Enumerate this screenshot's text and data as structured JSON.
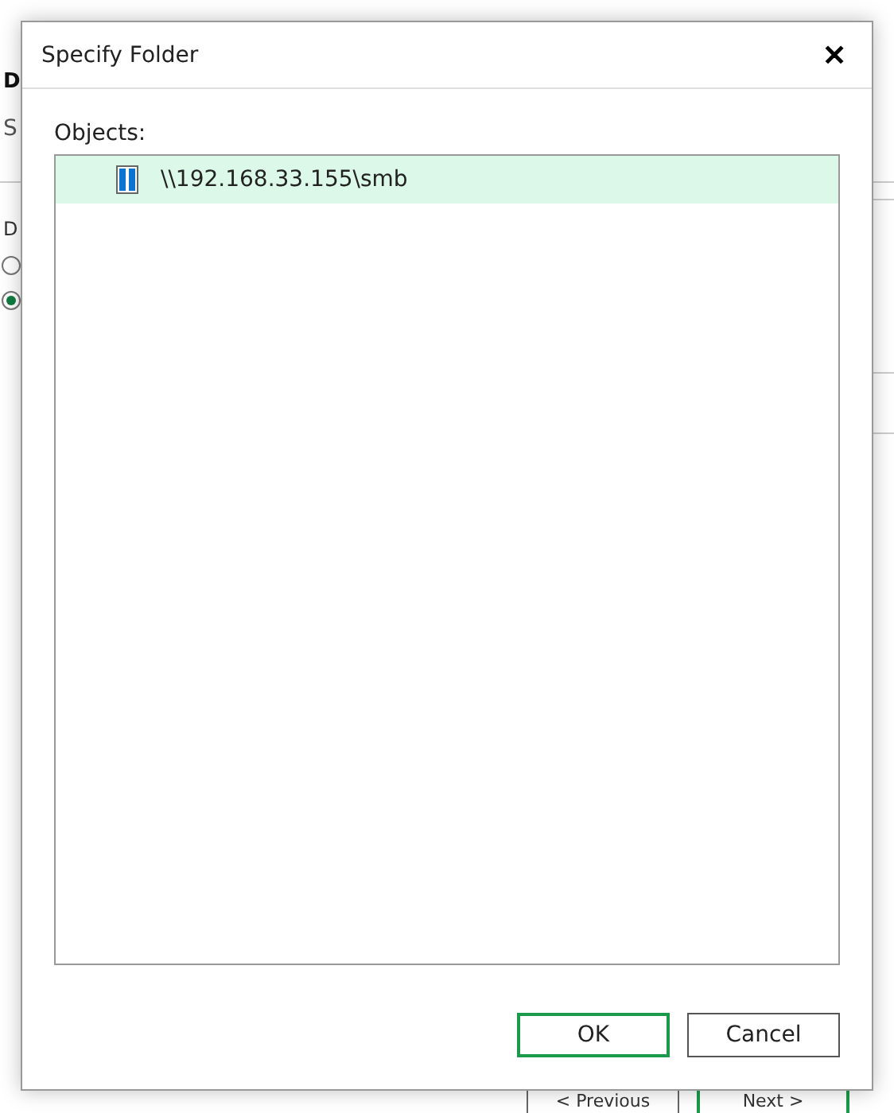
{
  "background_page": {
    "heading": "D",
    "subtitle": "S",
    "section_label": "D",
    "radios": [
      {
        "selected": false
      },
      {
        "selected": true
      }
    ],
    "buttons": [
      {
        "label": "< Previous",
        "kind": "normal"
      },
      {
        "label": "Next >",
        "kind": "default"
      }
    ]
  },
  "dialog": {
    "title": "Specify Folder",
    "close": "✕",
    "list_label": "Objects:",
    "objects": [
      {
        "name": "\\\\192.168.33.155\\smb",
        "selected": true
      }
    ],
    "buttons": [
      {
        "label": "OK",
        "kind": "default"
      },
      {
        "label": "Cancel",
        "kind": "normal"
      }
    ]
  }
}
